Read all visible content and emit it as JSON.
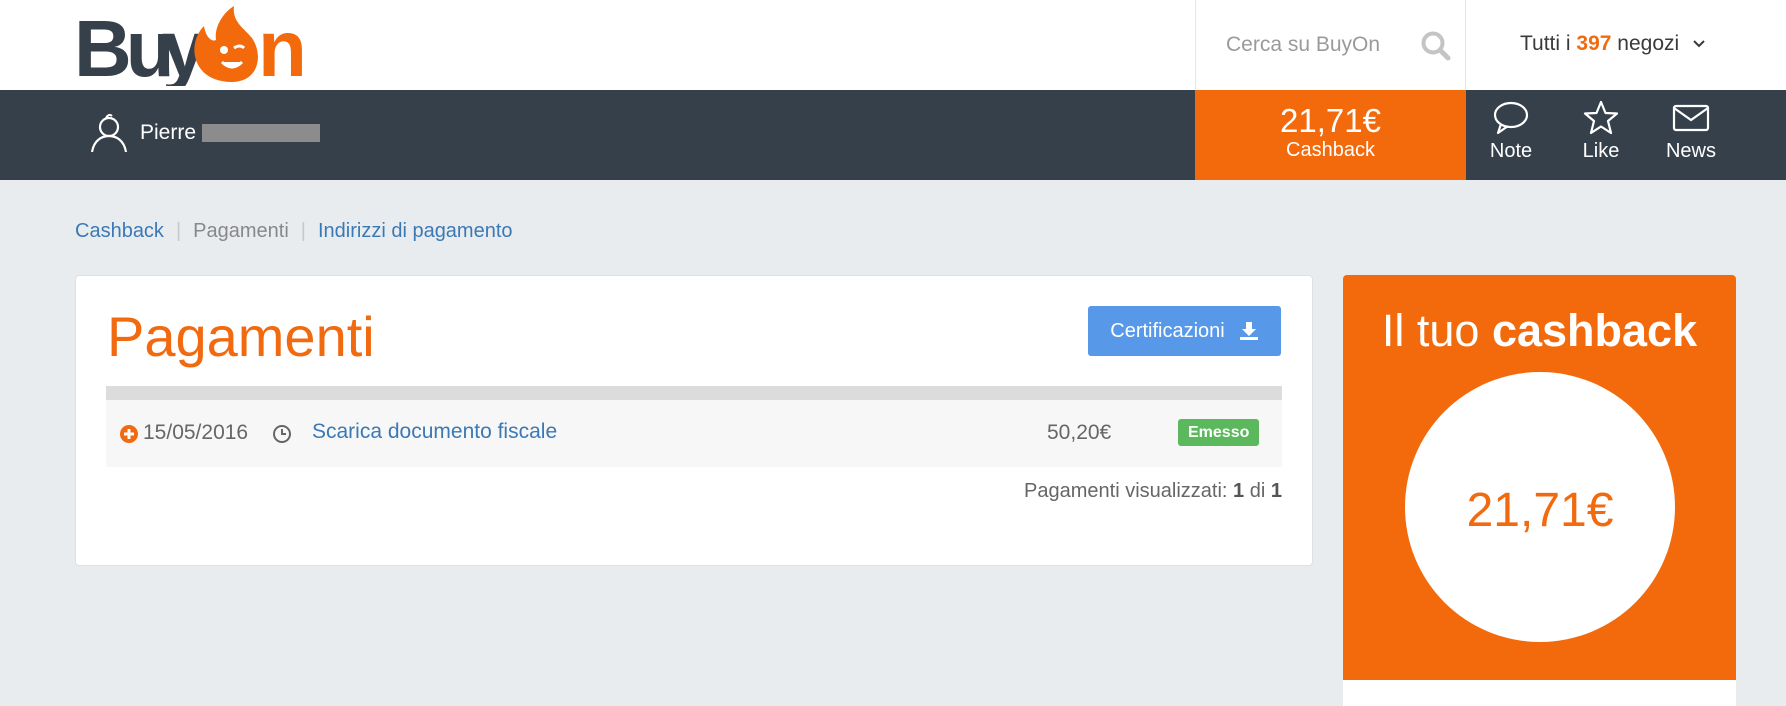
{
  "header": {
    "logo_text": "BuyOn",
    "search": {
      "placeholder": "Cerca su BuyOn"
    },
    "stores": {
      "prefix": "Tutti i",
      "count": "397",
      "suffix": "negozi"
    }
  },
  "userbar": {
    "user_name": "Pierre",
    "cashback": {
      "amount": "21,71€",
      "label": "Cashback"
    },
    "nav": [
      {
        "label": "Note",
        "icon": "speech-bubble-icon"
      },
      {
        "label": "Like",
        "icon": "star-icon"
      },
      {
        "label": "News",
        "icon": "envelope-icon"
      }
    ]
  },
  "breadcrumb": [
    {
      "label": "Cashback"
    },
    {
      "label": "Pagamenti"
    },
    {
      "label": "Indirizzi di pagamento"
    }
  ],
  "main": {
    "title": "Pagamenti",
    "cert_button": "Certificazioni",
    "rows": [
      {
        "date": "15/05/2016",
        "link": "Scarica documento fiscale",
        "amount": "50,20€",
        "status": "Emesso"
      }
    ],
    "pager": {
      "prefix": "Pagamenti visualizzati:",
      "shown": "1",
      "sep": "di",
      "total": "1"
    }
  },
  "sidebar": {
    "title_light": "Il tuo",
    "title_bold": "cashback",
    "amount": "21,71€"
  },
  "colors": {
    "brand_orange": "#f26a0c",
    "dark_bar": "#36404b",
    "link_blue": "#3b79b5",
    "button_blue": "#5898e8",
    "status_green": "#5cb85c"
  }
}
